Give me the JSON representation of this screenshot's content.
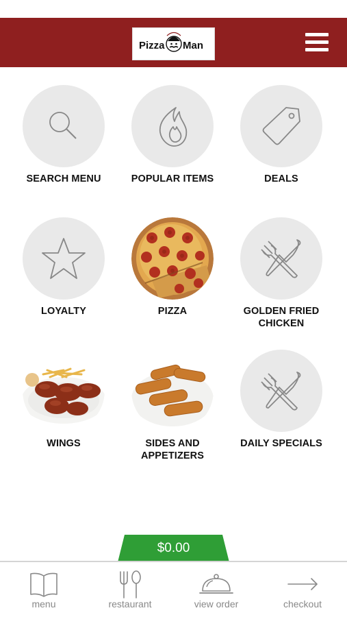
{
  "header": {
    "logo_text_left": "Pizza",
    "logo_text_right": "Man"
  },
  "tiles": [
    {
      "label": "SEARCH MENU"
    },
    {
      "label": "POPULAR ITEMS"
    },
    {
      "label": "DEALS"
    },
    {
      "label": "LOYALTY"
    },
    {
      "label": "PIZZA"
    },
    {
      "label": "GOLDEN FRIED CHICKEN"
    },
    {
      "label": "WINGS"
    },
    {
      "label": "SIDES AND APPETIZERS"
    },
    {
      "label": "DAILY SPECIALS"
    }
  ],
  "cart": {
    "total": "$0.00"
  },
  "bottom_nav": [
    {
      "label": "menu"
    },
    {
      "label": "restaurant"
    },
    {
      "label": "view order"
    },
    {
      "label": "checkout"
    }
  ],
  "colors": {
    "header_bg": "#8f1f1f",
    "accent_green": "#2f9e36",
    "tile_bg": "#e9e9e9"
  }
}
